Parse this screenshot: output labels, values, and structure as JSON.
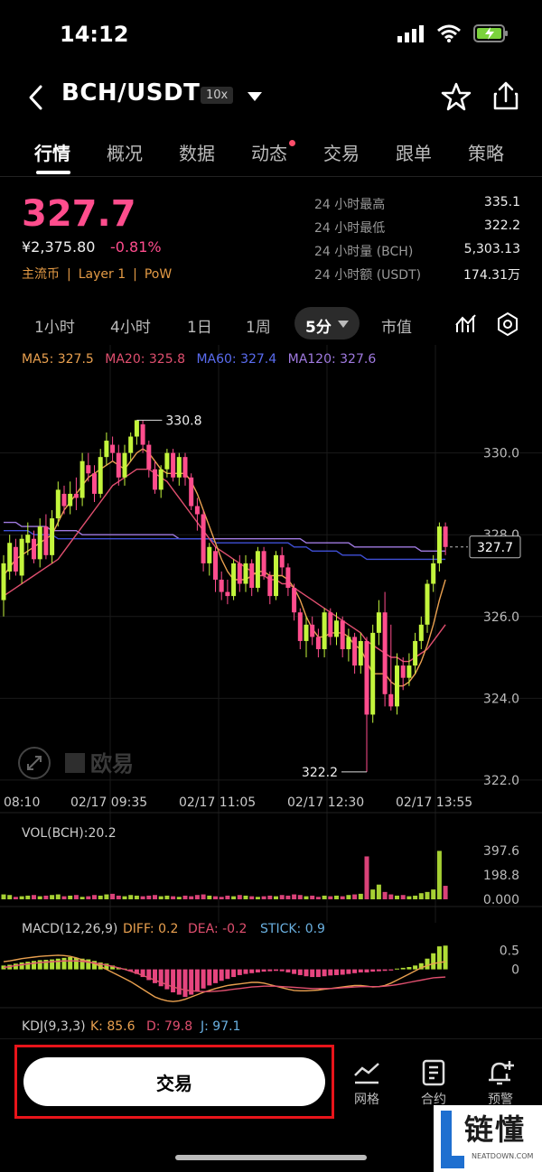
{
  "status": {
    "time": "14:12"
  },
  "header": {
    "pair": "BCH/USDT",
    "leverage": "10x"
  },
  "tabs": [
    "行情",
    "概况",
    "数据",
    "动态",
    "交易",
    "跟单",
    "策略"
  ],
  "price": {
    "last": "327.7",
    "cny": "¥2,375.80",
    "change": "-0.81%",
    "tags": [
      "主流币",
      "Layer 1",
      "PoW"
    ]
  },
  "stats": [
    {
      "label": "24 小时最高",
      "value": "335.1"
    },
    {
      "label": "24 小时最低",
      "value": "322.2"
    },
    {
      "label": "24 小时量 (BCH)",
      "value": "5,303.13"
    },
    {
      "label": "24 小时额 (USDT)",
      "value": "174.31万"
    }
  ],
  "periods": {
    "items": [
      "1小时",
      "4小时",
      "1日",
      "1周"
    ],
    "active": "5分",
    "market_cap": "市值"
  },
  "ma_legend": {
    "ma5": "MA5: 327.5",
    "ma20": "MA20: 325.8",
    "ma60": "MA60: 327.4",
    "ma120": "MA120: 327.6"
  },
  "colors": {
    "up": "#c3f53c",
    "down": "#ff4d8d",
    "ma5": "#e9a04f",
    "ma20": "#e04f6f",
    "ma60": "#3f4fd6",
    "ma120": "#a07ae0"
  },
  "chart_data": {
    "type": "candlestick",
    "price_axis": [
      "330.0",
      "328.0",
      "326.0",
      "324.0",
      "322.0"
    ],
    "ylim": [
      321.6,
      332.2
    ],
    "time_labels": [
      "08:10",
      "02/17 09:35",
      "02/17 11:05",
      "02/17 12:30",
      "02/17 13:55"
    ],
    "high_label": "330.8",
    "low_label": "322.2",
    "current_price": "327.7",
    "watermark": "欧易",
    "candles": [
      [
        326.4,
        327.3,
        326.0,
        327.5
      ],
      [
        327.1,
        327.8,
        326.9,
        328.0
      ],
      [
        327.7,
        327.1,
        327.0,
        327.9
      ],
      [
        327.0,
        327.9,
        326.8,
        328.0
      ],
      [
        327.8,
        328.0,
        327.5,
        328.3
      ],
      [
        327.9,
        327.4,
        327.3,
        328.1
      ],
      [
        327.4,
        328.2,
        327.2,
        328.4
      ],
      [
        328.2,
        327.5,
        327.4,
        328.5
      ],
      [
        327.5,
        328.4,
        327.3,
        328.6
      ],
      [
        328.4,
        329.1,
        328.2,
        329.3
      ],
      [
        329.0,
        328.7,
        328.5,
        329.2
      ],
      [
        328.7,
        329.0,
        328.5,
        329.3
      ],
      [
        329.0,
        328.9,
        328.6,
        329.4
      ],
      [
        328.9,
        329.8,
        328.7,
        330.0
      ],
      [
        329.7,
        329.5,
        329.3,
        330.0
      ],
      [
        329.5,
        329.0,
        328.8,
        329.7
      ],
      [
        329.0,
        329.9,
        328.9,
        330.1
      ],
      [
        329.9,
        330.3,
        329.7,
        330.5
      ],
      [
        330.2,
        330.0,
        329.8,
        330.4
      ],
      [
        330.0,
        329.4,
        329.2,
        330.2
      ],
      [
        329.4,
        330.0,
        329.2,
        330.2
      ],
      [
        330.0,
        330.4,
        329.8,
        330.5
      ],
      [
        330.4,
        330.8,
        330.2,
        330.8
      ],
      [
        330.7,
        330.2,
        330.0,
        330.8
      ],
      [
        330.2,
        329.6,
        329.4,
        330.3
      ],
      [
        329.6,
        329.1,
        329.0,
        329.8
      ],
      [
        329.1,
        329.6,
        328.9,
        329.7
      ],
      [
        329.6,
        330.0,
        329.4,
        330.1
      ],
      [
        330.0,
        329.4,
        329.3,
        330.1
      ],
      [
        329.4,
        329.9,
        329.2,
        330.0
      ],
      [
        329.9,
        329.4,
        329.2,
        330.0
      ],
      [
        329.4,
        328.7,
        328.6,
        329.5
      ],
      [
        328.7,
        328.5,
        328.1,
        328.9
      ],
      [
        328.5,
        327.3,
        327.1,
        328.6
      ],
      [
        327.3,
        327.7,
        327.0,
        327.8
      ],
      [
        327.6,
        326.9,
        326.6,
        327.7
      ],
      [
        326.9,
        326.6,
        326.4,
        327.1
      ],
      [
        326.6,
        326.5,
        326.3,
        326.9
      ],
      [
        326.5,
        327.3,
        326.4,
        327.4
      ],
      [
        327.3,
        326.8,
        326.6,
        327.5
      ],
      [
        326.8,
        327.3,
        326.6,
        327.5
      ],
      [
        327.3,
        326.7,
        326.5,
        327.4
      ],
      [
        326.7,
        327.6,
        326.6,
        327.7
      ],
      [
        327.6,
        327.0,
        326.9,
        327.7
      ],
      [
        327.0,
        326.5,
        326.3,
        327.1
      ],
      [
        326.5,
        327.5,
        326.4,
        327.6
      ],
      [
        327.5,
        327.2,
        327.0,
        327.7
      ],
      [
        327.2,
        326.7,
        326.5,
        327.3
      ],
      [
        326.7,
        326.1,
        325.9,
        326.8
      ],
      [
        326.1,
        325.4,
        325.2,
        326.2
      ],
      [
        325.4,
        325.8,
        325.0,
        326.0
      ],
      [
        325.8,
        325.5,
        325.3,
        326.0
      ],
      [
        325.5,
        325.2,
        325.0,
        325.7
      ],
      [
        325.2,
        326.1,
        325.0,
        326.2
      ],
      [
        326.1,
        325.5,
        325.3,
        326.2
      ],
      [
        325.5,
        325.9,
        325.3,
        326.1
      ],
      [
        325.9,
        325.2,
        325.0,
        326.0
      ],
      [
        325.2,
        325.5,
        324.9,
        325.7
      ],
      [
        325.5,
        324.8,
        324.6,
        325.6
      ],
      [
        324.8,
        325.4,
        324.6,
        325.6
      ],
      [
        325.4,
        323.6,
        322.2,
        325.5
      ],
      [
        323.6,
        325.6,
        323.4,
        325.8
      ],
      [
        325.6,
        326.1,
        325.3,
        326.4
      ],
      [
        326.1,
        324.1,
        323.8,
        326.6
      ],
      [
        324.1,
        323.8,
        323.7,
        325.8
      ],
      [
        323.8,
        324.8,
        323.6,
        325.1
      ],
      [
        324.8,
        324.5,
        324.2,
        325.0
      ],
      [
        324.5,
        324.8,
        324.3,
        325.1
      ],
      [
        324.8,
        325.4,
        324.6,
        325.6
      ],
      [
        325.4,
        325.8,
        325.2,
        326.0
      ],
      [
        325.8,
        326.8,
        325.6,
        326.9
      ],
      [
        326.8,
        327.3,
        326.6,
        327.5
      ],
      [
        327.3,
        328.2,
        327.1,
        328.3
      ],
      [
        328.2,
        327.7,
        327.5,
        328.3
      ]
    ],
    "ma5": [
      327.0,
      327.2,
      327.4,
      327.5,
      327.6,
      327.7,
      327.8,
      327.9,
      328.0,
      328.3,
      328.6,
      328.8,
      329.0,
      329.2,
      329.4,
      329.5,
      329.6,
      329.7,
      329.8,
      329.7,
      329.6,
      329.8,
      330.0,
      330.1,
      330.0,
      329.8,
      329.6,
      329.5,
      329.5,
      329.5,
      329.5,
      329.3,
      329.0,
      328.6,
      328.2,
      327.8,
      327.4,
      327.1,
      326.9,
      326.9,
      326.9,
      327.0,
      327.1,
      327.1,
      327.0,
      327.0,
      327.0,
      326.9,
      326.7,
      326.4,
      326.0,
      325.7,
      325.5,
      325.5,
      325.6,
      325.6,
      325.6,
      325.5,
      325.3,
      325.2,
      324.9,
      324.6,
      324.6,
      324.6,
      324.4,
      324.3,
      324.3,
      324.4,
      324.6,
      324.9,
      325.3,
      325.8,
      326.4,
      326.9
    ],
    "ma20": [
      326.5,
      326.6,
      326.7,
      326.8,
      326.9,
      327.0,
      327.1,
      327.2,
      327.3,
      327.4,
      327.6,
      327.8,
      328.0,
      328.2,
      328.4,
      328.6,
      328.8,
      329.0,
      329.2,
      329.3,
      329.4,
      329.5,
      329.6,
      329.6,
      329.6,
      329.5,
      329.4,
      329.3,
      329.1,
      328.9,
      328.7,
      328.5,
      328.3,
      328.1,
      327.9,
      327.7,
      327.6,
      327.5,
      327.4,
      327.3,
      327.2,
      327.1,
      327.0,
      327.0,
      326.9,
      326.9,
      326.8,
      326.8,
      326.7,
      326.6,
      326.5,
      326.4,
      326.3,
      326.2,
      326.1,
      326.0,
      325.9,
      325.8,
      325.7,
      325.6,
      325.4,
      325.3,
      325.2,
      325.1,
      325.0,
      325.0,
      324.9,
      324.9,
      325.0,
      325.1,
      325.2,
      325.4,
      325.6,
      325.8
    ],
    "ma60": [
      328.1,
      328.1,
      328.1,
      328.1,
      328.1,
      328.0,
      328.0,
      328.0,
      328.0,
      327.9,
      327.9,
      327.9,
      327.9,
      327.9,
      327.9,
      327.9,
      327.9,
      327.9,
      327.9,
      327.9,
      327.9,
      327.9,
      327.9,
      327.9,
      327.9,
      327.9,
      327.9,
      327.9,
      327.9,
      327.9,
      327.9,
      327.9,
      327.9,
      327.9,
      327.9,
      327.8,
      327.8,
      327.8,
      327.8,
      327.8,
      327.8,
      327.8,
      327.8,
      327.8,
      327.8,
      327.8,
      327.8,
      327.8,
      327.7,
      327.7,
      327.7,
      327.6,
      327.6,
      327.6,
      327.6,
      327.6,
      327.5,
      327.5,
      327.5,
      327.5,
      327.4,
      327.4,
      327.4,
      327.4,
      327.4,
      327.4,
      327.4,
      327.4,
      327.4,
      327.4,
      327.4,
      327.4,
      327.4,
      327.4
    ],
    "ma120": [
      328.3,
      328.3,
      328.3,
      328.2,
      328.2,
      328.2,
      328.2,
      328.2,
      328.1,
      328.1,
      328.1,
      328.1,
      328.1,
      328.0,
      328.0,
      328.0,
      328.0,
      328.0,
      328.0,
      328.0,
      328.0,
      328.0,
      328.0,
      328.0,
      328.0,
      328.0,
      328.0,
      328.0,
      328.0,
      327.9,
      327.9,
      327.9,
      327.9,
      327.9,
      327.9,
      327.9,
      327.9,
      327.9,
      327.9,
      327.9,
      327.9,
      327.9,
      327.9,
      327.9,
      327.9,
      327.9,
      327.9,
      327.9,
      327.9,
      327.9,
      327.8,
      327.8,
      327.8,
      327.8,
      327.8,
      327.8,
      327.8,
      327.8,
      327.7,
      327.7,
      327.7,
      327.7,
      327.7,
      327.7,
      327.7,
      327.7,
      327.7,
      327.7,
      327.7,
      327.6,
      327.6,
      327.6,
      327.6,
      327.6
    ],
    "volume": {
      "label": "VOL(BCH):20.2",
      "axis": [
        "397.6",
        "198.8",
        "0.000"
      ],
      "ymax": 397.6,
      "values": [
        40,
        35,
        20,
        25,
        30,
        35,
        25,
        30,
        35,
        40,
        25,
        30,
        35,
        20,
        25,
        35,
        30,
        40,
        45,
        30,
        25,
        35,
        30,
        25,
        30,
        35,
        25,
        30,
        25,
        20,
        30,
        25,
        35,
        40,
        30,
        25,
        20,
        30,
        25,
        35,
        30,
        25,
        20,
        25,
        30,
        25,
        35,
        30,
        40,
        35,
        25,
        30,
        20,
        30,
        25,
        30,
        25,
        35,
        40,
        45,
        350,
        80,
        120,
        60,
        40,
        30,
        35,
        25,
        30,
        50,
        60,
        80,
        395,
        110
      ]
    },
    "macd": {
      "label": "MACD(12,26,9)",
      "diff_label": "DIFF: 0.2",
      "dea_label": "DEA: -0.2",
      "stick_label": "STICK: 0.9",
      "axis": [
        "0.5",
        "0"
      ],
      "ymin": -1.0,
      "ymax": 0.65,
      "hist": [
        0.1,
        0.12,
        0.15,
        0.18,
        0.2,
        0.22,
        0.24,
        0.25,
        0.26,
        0.28,
        0.3,
        0.32,
        0.3,
        0.28,
        0.26,
        0.22,
        0.18,
        0.15,
        0.1,
        0.05,
        0.02,
        -0.05,
        -0.12,
        -0.2,
        -0.28,
        -0.36,
        -0.44,
        -0.52,
        -0.6,
        -0.66,
        -0.72,
        -0.66,
        -0.58,
        -0.5,
        -0.42,
        -0.36,
        -0.3,
        -0.25,
        -0.2,
        -0.15,
        -0.12,
        -0.1,
        -0.08,
        -0.06,
        -0.05,
        -0.04,
        -0.05,
        -0.08,
        -0.12,
        -0.15,
        -0.18,
        -0.2,
        -0.2,
        -0.18,
        -0.16,
        -0.15,
        -0.14,
        -0.12,
        -0.1,
        -0.08,
        -0.08,
        -0.06,
        -0.05,
        -0.04,
        -0.03,
        0.02,
        0.04,
        0.06,
        0.1,
        0.16,
        0.28,
        0.42,
        0.6,
        0.62
      ],
      "diff": [
        0.2,
        0.22,
        0.25,
        0.28,
        0.3,
        0.32,
        0.34,
        0.35,
        0.36,
        0.37,
        0.36,
        0.34,
        0.3,
        0.25,
        0.2,
        0.15,
        0.08,
        0.0,
        -0.08,
        -0.16,
        -0.24,
        -0.32,
        -0.42,
        -0.52,
        -0.62,
        -0.72,
        -0.78,
        -0.82,
        -0.84,
        -0.82,
        -0.78,
        -0.72,
        -0.66,
        -0.6,
        -0.55,
        -0.5,
        -0.46,
        -0.42,
        -0.4,
        -0.38,
        -0.36,
        -0.34,
        -0.34,
        -0.36,
        -0.4,
        -0.44,
        -0.48,
        -0.52,
        -0.55,
        -0.56,
        -0.56,
        -0.55,
        -0.54,
        -0.52,
        -0.5,
        -0.48,
        -0.46,
        -0.44,
        -0.42,
        -0.42,
        -0.44,
        -0.46,
        -0.45,
        -0.42,
        -0.36,
        -0.28,
        -0.2,
        -0.12,
        -0.04,
        0.04,
        0.1,
        0.15,
        0.18,
        0.2
      ],
      "dea": [
        0.05,
        0.07,
        0.1,
        0.12,
        0.14,
        0.16,
        0.18,
        0.19,
        0.2,
        0.21,
        0.22,
        0.22,
        0.22,
        0.21,
        0.19,
        0.17,
        0.14,
        0.11,
        0.08,
        0.04,
        0.0,
        -0.05,
        -0.1,
        -0.16,
        -0.22,
        -0.28,
        -0.34,
        -0.4,
        -0.46,
        -0.5,
        -0.54,
        -0.56,
        -0.57,
        -0.58,
        -0.58,
        -0.57,
        -0.56,
        -0.54,
        -0.52,
        -0.5,
        -0.48,
        -0.46,
        -0.45,
        -0.44,
        -0.44,
        -0.44,
        -0.45,
        -0.46,
        -0.47,
        -0.48,
        -0.49,
        -0.5,
        -0.5,
        -0.5,
        -0.5,
        -0.49,
        -0.48,
        -0.47,
        -0.46,
        -0.45,
        -0.45,
        -0.45,
        -0.45,
        -0.44,
        -0.42,
        -0.4,
        -0.37,
        -0.34,
        -0.31,
        -0.28,
        -0.25,
        -0.22,
        -0.21,
        -0.2
      ]
    },
    "kdj": {
      "label": "KDJ(9,3,3)",
      "k_label": "K: 85.6",
      "d_label": "D: 79.8",
      "j_label": "J: 97.1"
    }
  },
  "bottom_bar": {
    "trade": "交易",
    "grid": "网格",
    "contract": "合约",
    "alert": "预警"
  },
  "watermark_brand": {
    "text": "链懂",
    "sub": "NEATDOWN.COM"
  }
}
